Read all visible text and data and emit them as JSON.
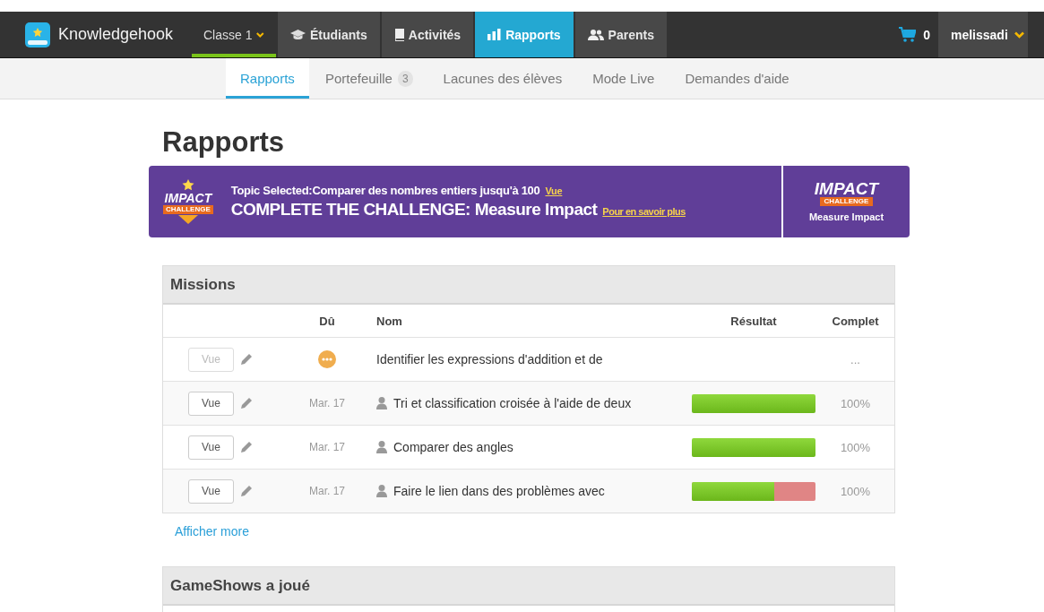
{
  "topbar": {
    "brand": "Knowledgehook",
    "nav": [
      {
        "label": "Classe 1",
        "kind": "dropdown",
        "selected": false
      },
      {
        "label": "Étudiants",
        "kind": "link",
        "selected": false
      },
      {
        "label": "Activités",
        "kind": "link",
        "selected": false
      },
      {
        "label": "Rapports",
        "kind": "link",
        "selected": true
      },
      {
        "label": "Parents",
        "kind": "link",
        "selected": false
      }
    ],
    "cart_count": "0",
    "user": "melissadi"
  },
  "subnav": [
    {
      "label": "Rapports",
      "selected": true
    },
    {
      "label": "Portefeuille",
      "badge": "3",
      "selected": false
    },
    {
      "label": "Lacunes des élèves",
      "selected": false
    },
    {
      "label": "Mode Live",
      "selected": false
    },
    {
      "label": "Demandes d'aide",
      "selected": false
    }
  ],
  "page_title": "Rapports",
  "banner": {
    "badge_title": "IMPACT",
    "badge_sub": "CHALLENGE",
    "topic": "Topic Selected:Comparer des nombres entiers jusqu'à 100",
    "topic_link": "Vue",
    "headline": "COMPLETE THE CHALLENGE: Measure Impact",
    "headline_link": "Pour en savoir plus",
    "side_title": "IMPACT",
    "side_sub": "CHALLENGE",
    "side_label": "Measure Impact"
  },
  "missions": {
    "title": "Missions",
    "columns": [
      "Dû",
      "Nom",
      "Résultat",
      "Complet"
    ],
    "rows": [
      {
        "kind": "pending",
        "view": "Vue",
        "disabled": true,
        "name": "Identifier les expressions d'addition et de",
        "complete": "..."
      },
      {
        "kind": "assigned",
        "view": "Vue",
        "disabled": false,
        "due": "Mar. 17",
        "name": "Tri et classification croisée à l'aide de deux",
        "level": 1,
        "complete": "100%"
      },
      {
        "kind": "assigned",
        "view": "Vue",
        "disabled": false,
        "due": "Mar. 17",
        "name": "Comparer des angles",
        "level": 1,
        "complete": "100%"
      },
      {
        "kind": "assigned",
        "view": "Vue",
        "disabled": false,
        "due": "Mar. 17",
        "name": "Faire le lien dans des problèmes avec",
        "level": 0.67,
        "complete": "100%"
      }
    ],
    "more": "Afficher more"
  },
  "gameshows": {
    "title": "GameShows a joué"
  }
}
